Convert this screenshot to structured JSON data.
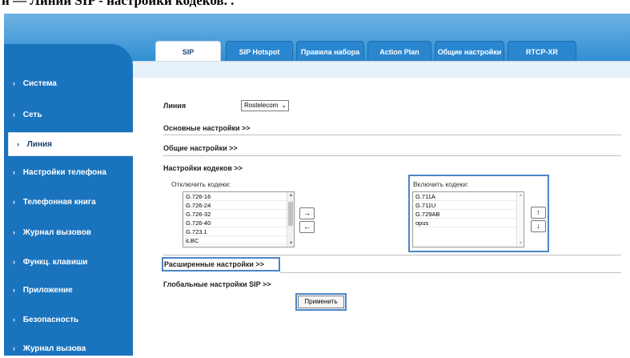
{
  "doc_caption": "н — Линии SIP - настройки кодеков. .",
  "sidebar": {
    "items": [
      {
        "label": "Система"
      },
      {
        "label": "Сеть"
      },
      {
        "label": "Линия"
      },
      {
        "label": "Настройки телефона"
      },
      {
        "label": "Телефонная книга"
      },
      {
        "label": "Журнал вызовов"
      },
      {
        "label": "Функц. клавиши"
      },
      {
        "label": "Приложение"
      },
      {
        "label": "Безопасность"
      },
      {
        "label": "Журнал вызова"
      }
    ]
  },
  "tabs": [
    {
      "label": "SIP"
    },
    {
      "label": "SIP Hotspot"
    },
    {
      "label": "Правила набора"
    },
    {
      "label": "Action Plan"
    },
    {
      "label": "Общие настройки"
    },
    {
      "label": "RTCP-XR"
    }
  ],
  "line": {
    "label": "Линия",
    "selected": "Rostelecom"
  },
  "sections": {
    "basic": "Основные настройки >>",
    "general": "Общие настройки >>",
    "codecs": "Настройки кодеков >>",
    "advanced": "Расширенные настройки >>",
    "global_sip": "Глобальные настройки SIP >>"
  },
  "codecs": {
    "disabled_label": "Отключить кодеки:",
    "enabled_label": "Включить кодеки:",
    "disabled": [
      "G.726-16",
      "G.726-24",
      "G.726-32",
      "G.726-40",
      "G.723.1",
      "iLBC"
    ],
    "enabled": [
      "G.711A",
      "G.711U",
      "G.729AB",
      "opus"
    ],
    "move_right": "→",
    "move_left": "←",
    "move_up": "↑",
    "move_down": "↓"
  },
  "apply_button": "Применить",
  "colors": {
    "sidebar": "#1a73bd",
    "header": "#2f8fd3",
    "tab": "#2a86cf",
    "highlight": "#4a86c7"
  }
}
